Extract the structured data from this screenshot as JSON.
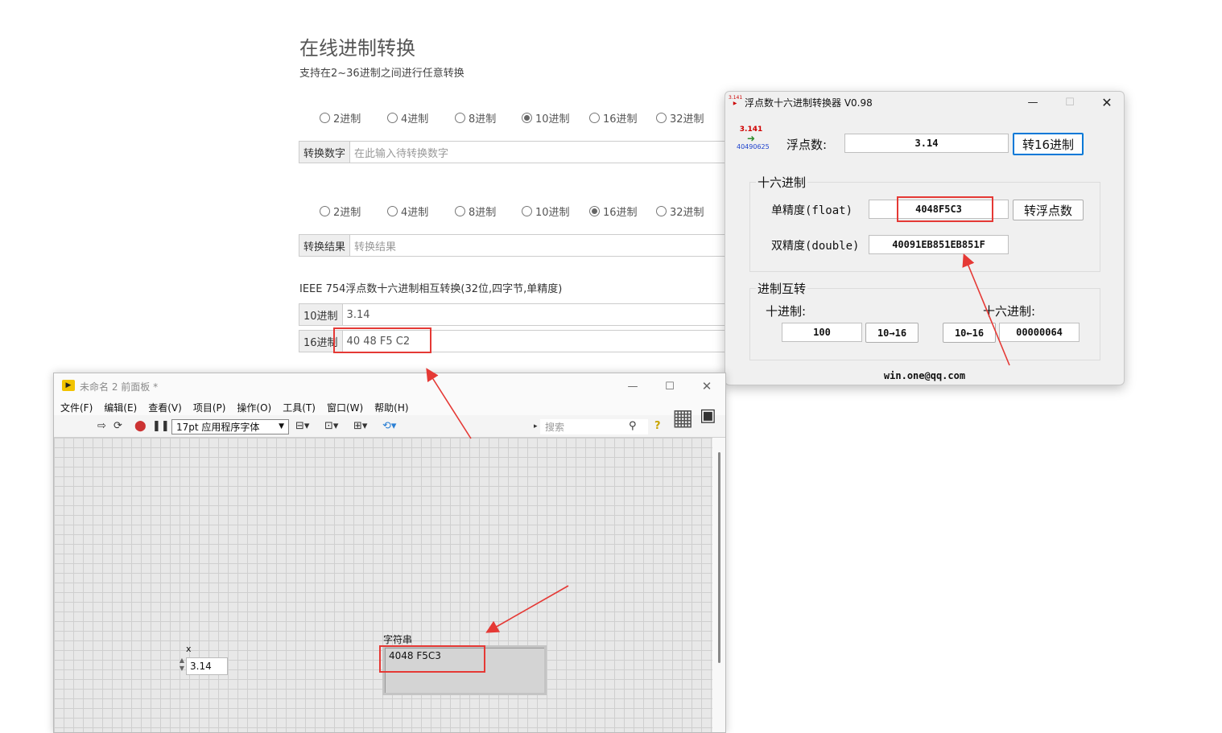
{
  "web": {
    "title": "在线进制转换",
    "subtitle": "支持在2~36进制之间进行任意转换",
    "from_bases": [
      "2进制",
      "4进制",
      "8进制",
      "10进制",
      "16进制",
      "32进制"
    ],
    "from_selected": "10进制",
    "input_label": "转换数字",
    "input_placeholder": "在此输入待转换数字",
    "to_bases": [
      "2进制",
      "4进制",
      "8进制",
      "10进制",
      "16进制",
      "32进制"
    ],
    "to_selected": "16进制",
    "result_label": "转换结果",
    "result_placeholder": "转换结果",
    "ieee_title": "IEEE 754浮点数十六进制相互转换(32位,四字节,单精度)",
    "dec_label": "10进制",
    "dec_value": "3.14",
    "hex_label": "16进制",
    "hex_value": "40 48 F5 C2"
  },
  "app": {
    "title": "浮点数十六进制转换器 V0.98",
    "icon_top": "3.141",
    "icon_bottom": "40490625",
    "float_label": "浮点数:",
    "float_value": "3.14",
    "to_hex_button": "转16进制",
    "hex_group": "十六进制",
    "single_label": "单精度(float)",
    "single_value": "4048F5C3",
    "to_float_button": "转浮点数",
    "double_label": "双精度(double)",
    "double_value": "40091EB851EB851F",
    "conv_group": "进制互转",
    "dec_label": "十进制:",
    "hex_label": "十六进制:",
    "dec_value": "100",
    "dec_to_hex_button": "10→16",
    "hex_to_dec_button": "10←16",
    "hex_value": "00000064",
    "footer": "win.one@qq.com"
  },
  "labview": {
    "title": "未命名 2 前面板 *",
    "menu": [
      "文件(F)",
      "编辑(E)",
      "查看(V)",
      "项目(P)",
      "操作(O)",
      "工具(T)",
      "窗口(W)",
      "帮助(H)"
    ],
    "font": "17pt 应用程序字体",
    "search_placeholder": "搜索",
    "numeric_label": "x",
    "numeric_value": "3.14",
    "string_label": "字符串",
    "string_value": "4048 F5C3"
  },
  "annotation_color": "#e53935"
}
